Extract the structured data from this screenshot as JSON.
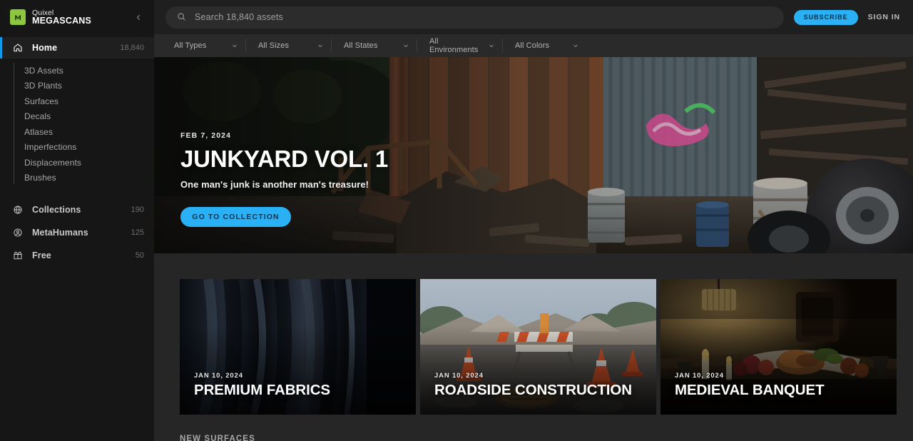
{
  "sidebar": {
    "brand": {
      "top": "Quixel",
      "bottom": "MEGASCANS",
      "logo_icon": "megascans-logo-icon"
    },
    "collapse_icon": "chevron-left-icon",
    "home": {
      "label": "Home",
      "count": "18,840",
      "icon": "home-icon"
    },
    "sub_items": [
      {
        "label": "3D Assets"
      },
      {
        "label": "3D Plants"
      },
      {
        "label": "Surfaces"
      },
      {
        "label": "Decals"
      },
      {
        "label": "Atlases"
      },
      {
        "label": "Imperfections"
      },
      {
        "label": "Displacements"
      },
      {
        "label": "Brushes"
      }
    ],
    "secondary_items": [
      {
        "label": "Collections",
        "count": "190",
        "icon": "globe-icon"
      },
      {
        "label": "MetaHumans",
        "count": "125",
        "icon": "user-circle-icon"
      },
      {
        "label": "Free",
        "count": "50",
        "icon": "gift-icon"
      }
    ]
  },
  "topbar": {
    "search": {
      "placeholder": "Search 18,840 assets",
      "value": "",
      "icon": "search-icon"
    },
    "subscribe_label": "SUBSCRIBE",
    "signin_label": "SIGN IN"
  },
  "filters": [
    {
      "label": "All Types",
      "icon": "chevron-down-icon"
    },
    {
      "label": "All Sizes",
      "icon": "chevron-down-icon"
    },
    {
      "label": "All States",
      "icon": "chevron-down-icon"
    },
    {
      "label": "All Environments",
      "icon": "chevron-down-icon"
    },
    {
      "label": "All Colors",
      "icon": "chevron-down-icon"
    }
  ],
  "hero": {
    "date": "FEB 7, 2024",
    "title": "JUNKYARD VOL. 1",
    "subtitle": "One man's junk is another man's treasure!",
    "cta_label": "GO TO COLLECTION"
  },
  "cards": [
    {
      "date": "JAN 10, 2024",
      "title": "PREMIUM FABRICS"
    },
    {
      "date": "JAN 10, 2024",
      "title": "ROADSIDE CONSTRUCTION"
    },
    {
      "date": "JAN 10, 2024",
      "title": "MEDIEVAL BANQUET"
    }
  ],
  "section": {
    "new_surfaces_label": "NEW SURFACES"
  },
  "colors": {
    "accent_blue": "#2ab0f5",
    "active_bar": "#0e9ae8",
    "logo_green": "#8dc63f",
    "sidebar_bg": "#161616",
    "main_bg": "#262626"
  }
}
